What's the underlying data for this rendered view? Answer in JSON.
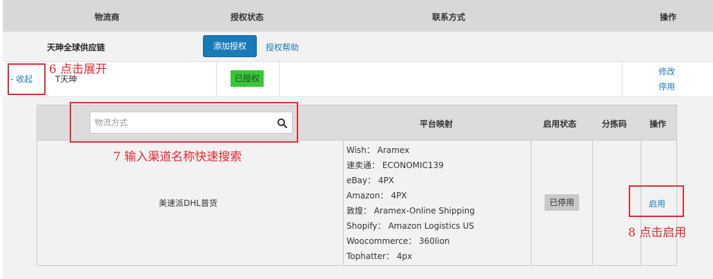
{
  "header": {
    "col_carrier": "物流商",
    "col_auth_status": "授权状态",
    "col_contact": "联系方式",
    "col_actions": "操作"
  },
  "carrier": {
    "name": "天珅全球供应链",
    "add_auth_label": "添加授权",
    "auth_help_label": "授权帮助"
  },
  "account": {
    "collapse_label": "- 收起",
    "name": "T天珅",
    "status": "已授权",
    "status_color": "#3ac53a",
    "edit_label": "修改",
    "disable_label": "停用"
  },
  "sub_table": {
    "search_placeholder": "物流方式",
    "search_value": "",
    "col_platform_mapping": "平台映射",
    "col_enable_status": "启用状态",
    "col_sort_code": "分拣码",
    "col_actions": "操作",
    "rows": [
      {
        "method": "美速派DHL普货",
        "mappings": [
          "Wish：  Aramex",
          "速卖通：  ECONOMIC139",
          "eBay：  4PX",
          "Amazon：  4PX",
          "敦煌：  Aramex-Online Shipping",
          "Shopify：  Amazon Logistics US",
          "Woocommerce：  360lion",
          "Tophatter：  4px"
        ],
        "status": "已停用",
        "sort_code": "",
        "enable_label": "启用"
      }
    ]
  },
  "annotations": {
    "step6": "6  点击展开",
    "step7": "7  输入渠道名称快速搜索",
    "step8": "8  点击启用",
    "color": "#e0282f"
  }
}
